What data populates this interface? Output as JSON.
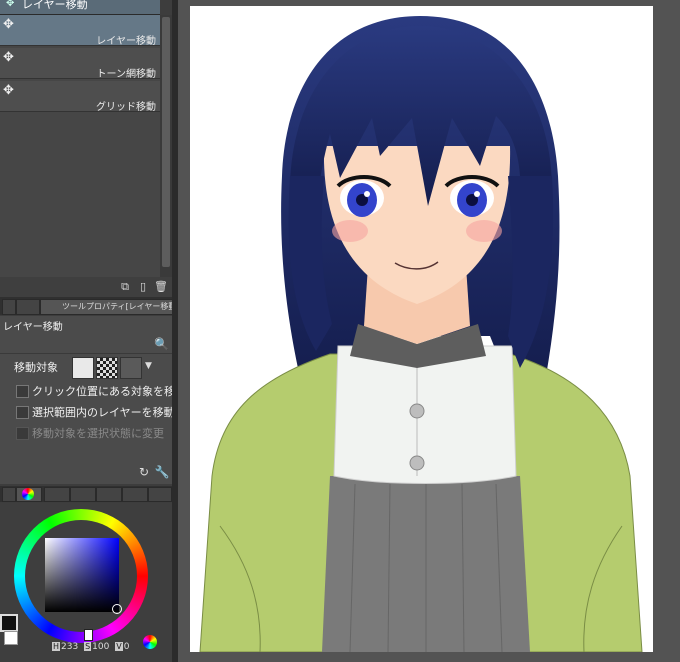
{
  "subtool_panel": {
    "header_label": "レイヤー移動",
    "items": [
      {
        "label": "レイヤー移動",
        "selected": true,
        "icon": "move-cursor-icon"
      },
      {
        "label": "トーン網移動",
        "selected": false,
        "icon": "move-cursor-icon"
      },
      {
        "label": "グリッド移動",
        "selected": false,
        "icon": "move-cursor-icon"
      }
    ],
    "footer_icons": [
      "copy-subtool-icon",
      "new-subtool-icon",
      "delete-subtool-icon"
    ]
  },
  "tool_property": {
    "tab_title": "ツールプロパティ[レイヤー移動]",
    "tool_name": "レイヤー移動",
    "target_label": "移動対象",
    "options": [
      {
        "label": "クリック位置にある対象を移動",
        "checked": false,
        "enabled": true
      },
      {
        "label": "選択範囲内のレイヤーを移動",
        "checked": false,
        "enabled": true
      },
      {
        "label": "移動対象を選択状態に変更",
        "checked": false,
        "enabled": false
      }
    ]
  },
  "color_panel": {
    "h_label": "H",
    "h_value": "233",
    "s_label": "S",
    "s_value": "100",
    "v_label": "V",
    "v_value": "0",
    "main_color": "#111111",
    "sub_color": "#ffffff"
  },
  "colors": {
    "hair": "#1d2a66",
    "skin": "#fbd9c1",
    "cardigan": "#b5cc6e",
    "shirt": "#f1f3f1",
    "vest": "#7a7a7a",
    "eyes": "#3344cc"
  }
}
